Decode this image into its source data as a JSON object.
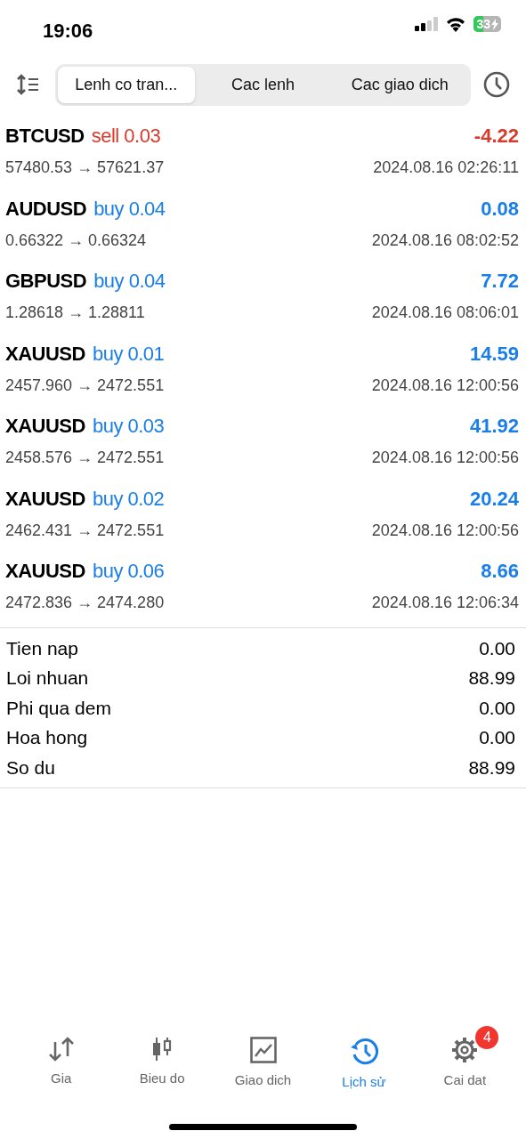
{
  "status_bar": {
    "time": "19:06",
    "battery": "33"
  },
  "tabs": [
    {
      "label": "Lenh co tran...",
      "selected": true
    },
    {
      "label": "Cac lenh",
      "selected": false
    },
    {
      "label": "Cac giao dich",
      "selected": false
    }
  ],
  "trades": [
    {
      "symbol": "BTCUSD",
      "kind": "sell",
      "order": "sell 0.03",
      "profit": "-4.22",
      "prices": "57480.53 → 57621.37",
      "time": "2024.08.16 02:26:11"
    },
    {
      "symbol": "AUDUSD",
      "kind": "buy",
      "order": "buy 0.04",
      "profit": "0.08",
      "prices": "0.66322 → 0.66324",
      "time": "2024.08.16 08:02:52"
    },
    {
      "symbol": "GBPUSD",
      "kind": "buy",
      "order": "buy 0.04",
      "profit": "7.72",
      "prices": "1.28618 → 1.28811",
      "time": "2024.08.16 08:06:01"
    },
    {
      "symbol": "XAUUSD",
      "kind": "buy",
      "order": "buy 0.01",
      "profit": "14.59",
      "prices": "2457.960 → 2472.551",
      "time": "2024.08.16 12:00:56"
    },
    {
      "symbol": "XAUUSD",
      "kind": "buy",
      "order": "buy 0.03",
      "profit": "41.92",
      "prices": "2458.576 → 2472.551",
      "time": "2024.08.16 12:00:56"
    },
    {
      "symbol": "XAUUSD",
      "kind": "buy",
      "order": "buy 0.02",
      "profit": "20.24",
      "prices": "2462.431 → 2472.551",
      "time": "2024.08.16 12:00:56"
    },
    {
      "symbol": "XAUUSD",
      "kind": "buy",
      "order": "buy 0.06",
      "profit": "8.66",
      "prices": "2472.836 → 2474.280",
      "time": "2024.08.16 12:06:34"
    }
  ],
  "summary": [
    {
      "label": "Tien nap",
      "value": "0.00"
    },
    {
      "label": "Loi nhuan",
      "value": "88.99"
    },
    {
      "label": "Phi qua dem",
      "value": "0.00"
    },
    {
      "label": "Hoa hong",
      "value": "0.00"
    },
    {
      "label": "So du",
      "value": "88.99"
    }
  ],
  "nav": [
    {
      "kind": "quotes",
      "label": "Gia",
      "selected": false
    },
    {
      "kind": "chart",
      "label": "Bieu do",
      "selected": false
    },
    {
      "kind": "trade",
      "label": "Giao dich",
      "selected": false
    },
    {
      "kind": "history",
      "label": "Lịch sử",
      "selected": true
    },
    {
      "kind": "settings",
      "label": "Cai dat",
      "selected": false,
      "badge": "4"
    }
  ]
}
